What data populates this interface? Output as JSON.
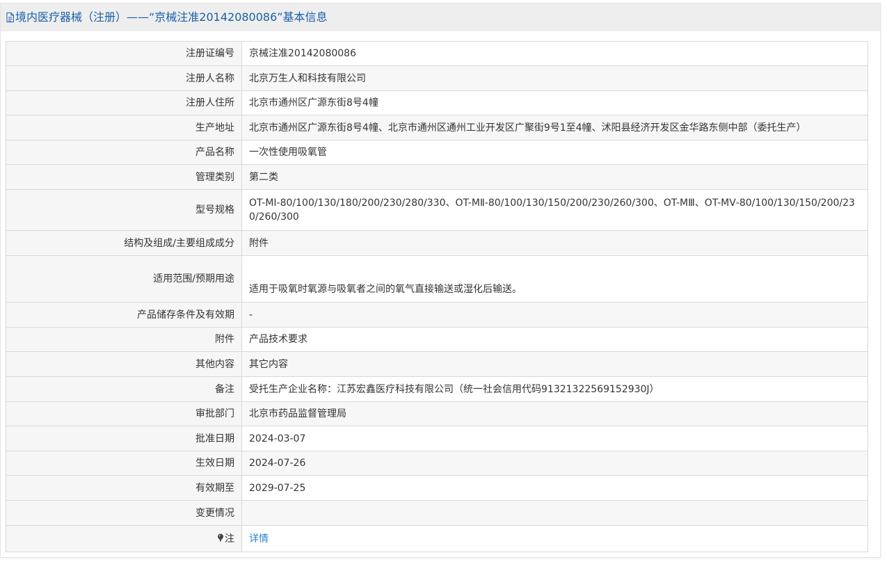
{
  "header": {
    "title": "境内医疗器械（注册）——“京械注准20142080086”基本信息"
  },
  "rows": [
    {
      "label": "注册证编号",
      "value": "京械注准20142080086"
    },
    {
      "label": "注册人名称",
      "value": "北京万生人和科技有限公司"
    },
    {
      "label": "注册人住所",
      "value": "北京市通州区广源东街8号4幢"
    },
    {
      "label": "生产地址",
      "value": "北京市通州区广源东街8号4幢、北京市通州区通州工业开发区广聚街9号1至4幢、沭阳县经济开发区金华路东侧中部（委托生产）"
    },
    {
      "label": "产品名称",
      "value": "一次性使用吸氧管"
    },
    {
      "label": "管理类别",
      "value": "第二类"
    },
    {
      "label": "型号规格",
      "value": "OT-MⅠ-80/100/130/180/200/230/280/330、OT-MⅡ-80/100/130/150/200/230/260/300、OT-MⅢ、OT-MⅤ-80/100/130/150/200/230/260/300"
    },
    {
      "label": "结构及组成/主要组成成分",
      "value": "附件"
    },
    {
      "label": "适用范围/预期用途",
      "value": "适用于吸氧时氧源与吸氧者之间的氧气直接输送或湿化后输送。"
    },
    {
      "label": "产品储存条件及有效期",
      "value": "-"
    },
    {
      "label": "附件",
      "value": "产品技术要求"
    },
    {
      "label": "其他内容",
      "value": "其它内容"
    },
    {
      "label": "备注",
      "value": "受托生产企业名称：江苏宏鑫医疗科技有限公司（统一社会信用代码91321322569152930J）"
    },
    {
      "label": "审批部门",
      "value": "北京市药品监督管理局"
    },
    {
      "label": "批准日期",
      "value": "2024-03-07"
    },
    {
      "label": "生效日期",
      "value": "2024-07-26"
    },
    {
      "label": "有效期至",
      "value": "2029-07-25"
    },
    {
      "label": "变更情况",
      "value": ""
    },
    {
      "label": "注",
      "value": "详情"
    }
  ],
  "icons": {
    "header_icon": "document-icon",
    "note_icon": "pin-icon"
  },
  "colors": {
    "title": "#1a5fa8",
    "link": "#2d7fd3",
    "header_bg": "#eeeeee",
    "label_bg": "#f6f6f6"
  }
}
